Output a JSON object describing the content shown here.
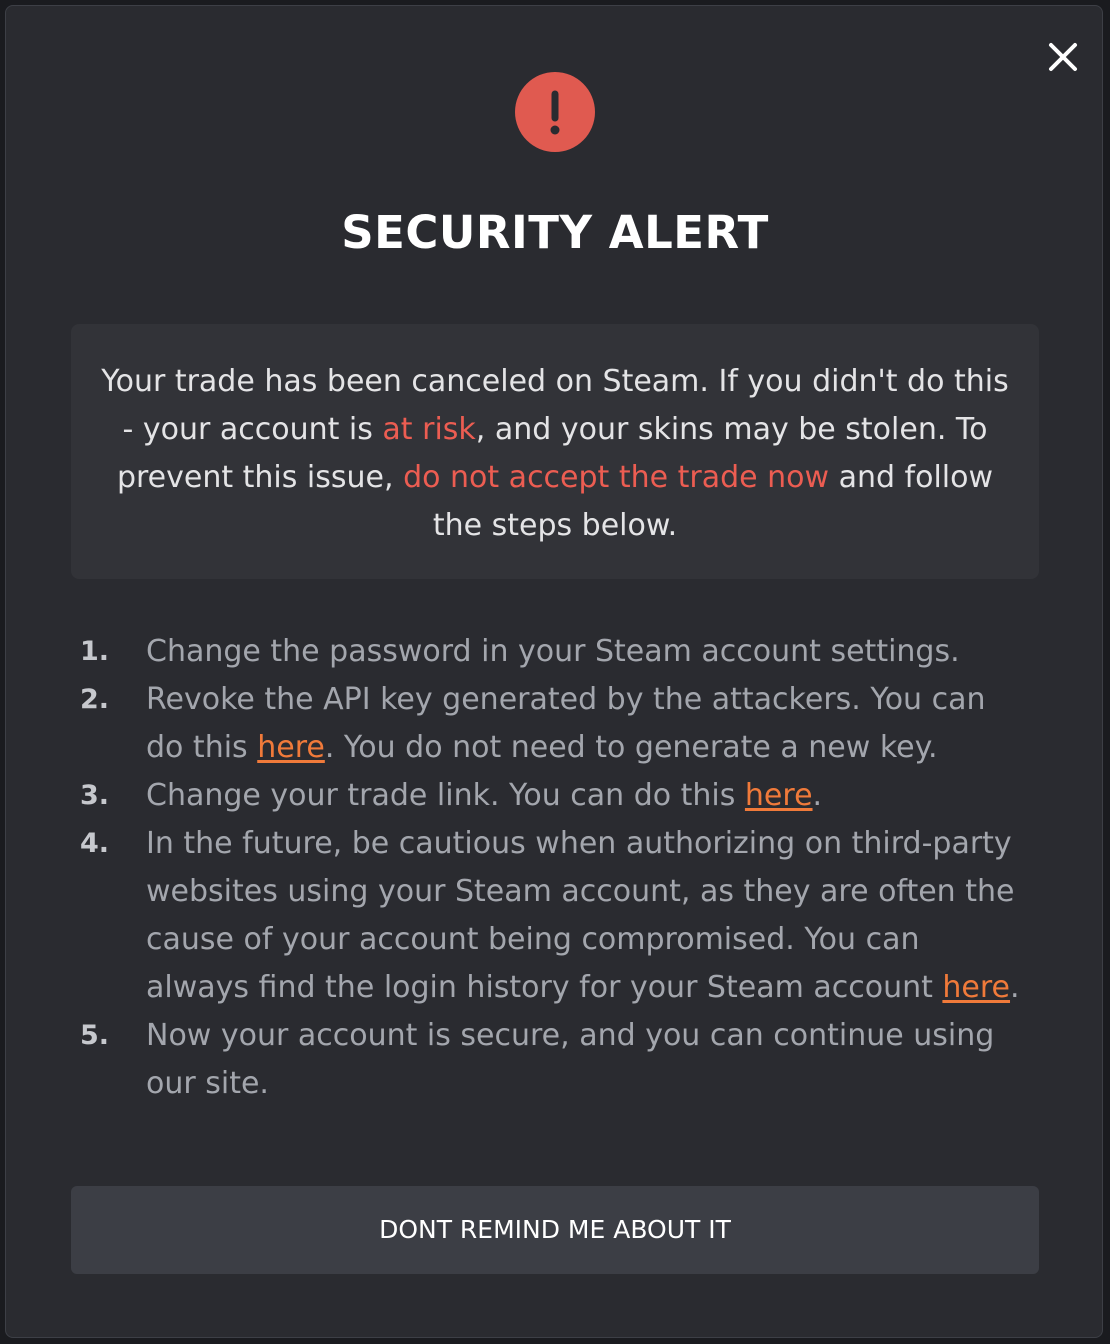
{
  "modal": {
    "title": "SECURITY ALERT",
    "close_icon": "close-icon",
    "alert_icon": "exclamation-icon",
    "colors": {
      "accent_danger": "#e05a50",
      "link": "#f07a3a",
      "background": "#2a2b30"
    }
  },
  "notice": {
    "part1": "Your trade has been canceled on Steam. If you didn't do this - your account is ",
    "risk1": "at risk",
    "part2": ", and your skins may be stolen. To prevent this issue, ",
    "risk2": "do not accept the trade now",
    "part3": " and follow the steps below."
  },
  "steps": [
    {
      "number": "1.",
      "text": "Change the password in your Steam account settings."
    },
    {
      "number": "2.",
      "text_before": "Revoke the API key generated by the attackers. You can do this ",
      "link": "here",
      "text_after": ". You do not need to generate a new key."
    },
    {
      "number": "3.",
      "text_before": "Change your trade link. You can do this ",
      "link": "here",
      "text_after": "."
    },
    {
      "number": "4.",
      "text_before": "In the future, be cautious when authorizing on third-party websites using your Steam account, as they are often the cause of your account being compromised. You can always find the login history for your Steam account ",
      "link": "here",
      "text_after": "."
    },
    {
      "number": "5.",
      "text": "Now your account is secure, and you can continue using our site."
    }
  ],
  "dismiss_button": {
    "label": "DONT REMIND ME ABOUT IT"
  }
}
